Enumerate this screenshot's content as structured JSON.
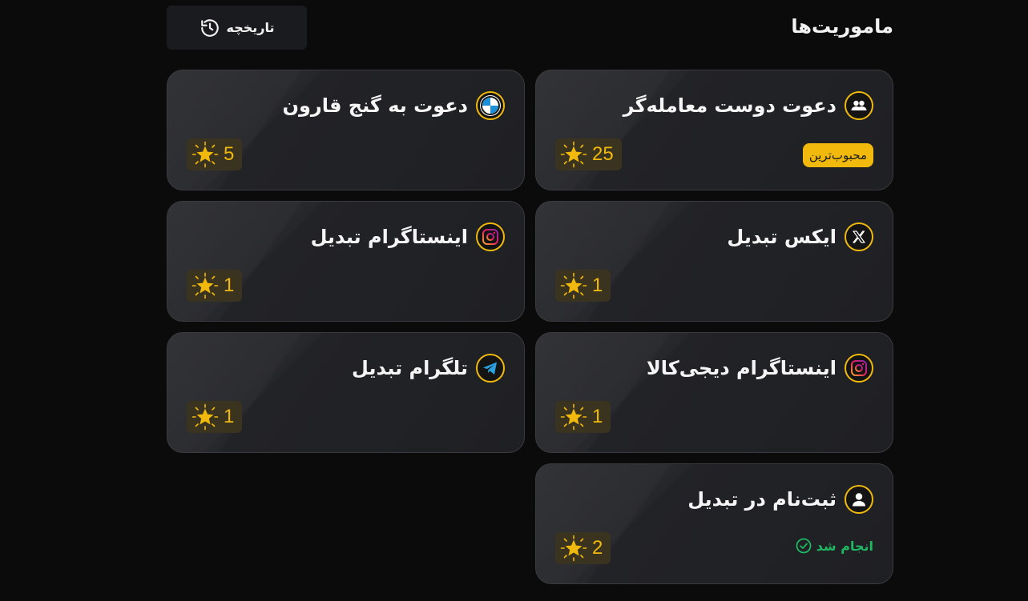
{
  "header": {
    "title": "ماموریت‌ها",
    "history_label": "تاریخچه",
    "history_icon": "history-icon"
  },
  "colors": {
    "accent": "#f0b90b",
    "background": "#0b0b0b",
    "card": "#232428",
    "success": "#1fb862"
  },
  "missions": [
    {
      "title": "دعوت دوست معامله‌گر",
      "icon": "users-icon",
      "reward": "25",
      "badge": "محبوب‌ترین"
    },
    {
      "title": "دعوت به گنج قارون",
      "icon": "bmw-logo-icon",
      "reward": "5"
    },
    {
      "title": "ایکس تبدیل",
      "icon": "x-logo-icon",
      "reward": "1"
    },
    {
      "title": "اینستاگرام تبدیل",
      "icon": "instagram-icon",
      "reward": "1"
    },
    {
      "title": "اینستاگرام دیجی‌کالا",
      "icon": "instagram-icon",
      "reward": "1"
    },
    {
      "title": "تلگرام تبدیل",
      "icon": "telegram-icon",
      "reward": "1"
    },
    {
      "title": "ثبت‌نام در تبدیل",
      "icon": "user-icon",
      "reward": "2",
      "status": "انجام شد"
    }
  ]
}
